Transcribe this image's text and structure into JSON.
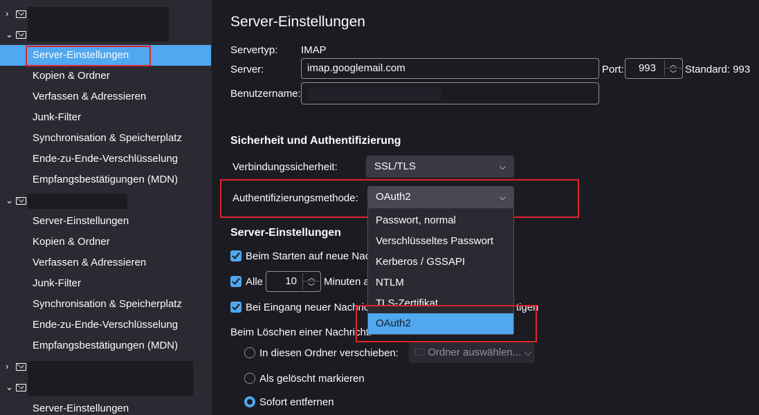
{
  "sidebar": {
    "selected_item": "Server-Einstellungen",
    "account1_items": [
      "Server-Einstellungen",
      "Kopien & Ordner",
      "Verfassen & Adressieren",
      "Junk-Filter",
      "Synchronisation & Speicherplatz",
      "Ende-zu-Ende-Verschlüsselung",
      "Empfangsbestätigungen (MDN)"
    ],
    "account2_items": [
      "Server-Einstellungen",
      "Kopien & Ordner",
      "Verfassen & Adressieren",
      "Junk-Filter",
      "Synchronisation & Speicherplatz",
      "Ende-zu-Ende-Verschlüsselung",
      "Empfangsbestätigungen (MDN)"
    ],
    "account3_items": [
      "Server-Einstellungen"
    ]
  },
  "main": {
    "title": "Server-Einstellungen",
    "servertyp_label": "Servertyp:",
    "servertyp_value": "IMAP",
    "server_label": "Server:",
    "server_value": "imap.googlemail.com",
    "port_label": "Port:",
    "port_value": "993",
    "standard_label": "Standard: 993",
    "username_label": "Benutzername:",
    "security_heading": "Sicherheit und Authentifizierung",
    "connection_label": "Verbindungssicherheit:",
    "connection_value": "SSL/TLS",
    "auth_label": "Authentifizierungsmethode:",
    "auth_value": "OAuth2",
    "auth_options": [
      "Passwort, normal",
      "Verschlüsseltes Passwort",
      "Kerberos / GSSAPI",
      "NTLM",
      "TLS-Zertifikat",
      "OAuth2"
    ],
    "server_settings_heading": "Server-Einstellungen",
    "check_startup": "Beim Starten auf neue Nac",
    "check_every_prefix": "Alle",
    "check_every_value": "10",
    "check_every_suffix": "Minuten a",
    "check_newmail_prefix": "Bei Eingang neuer Nachric",
    "check_newmail_suffix": "tigen",
    "delete_label": "Beim Löschen einer Nachricht:",
    "radio_move": "In diesen Ordner verschieben:",
    "folder_placeholder": "Ordner auswählen...",
    "radio_mark": "Als gelöscht markieren",
    "radio_remove": "Sofort entfernen"
  }
}
